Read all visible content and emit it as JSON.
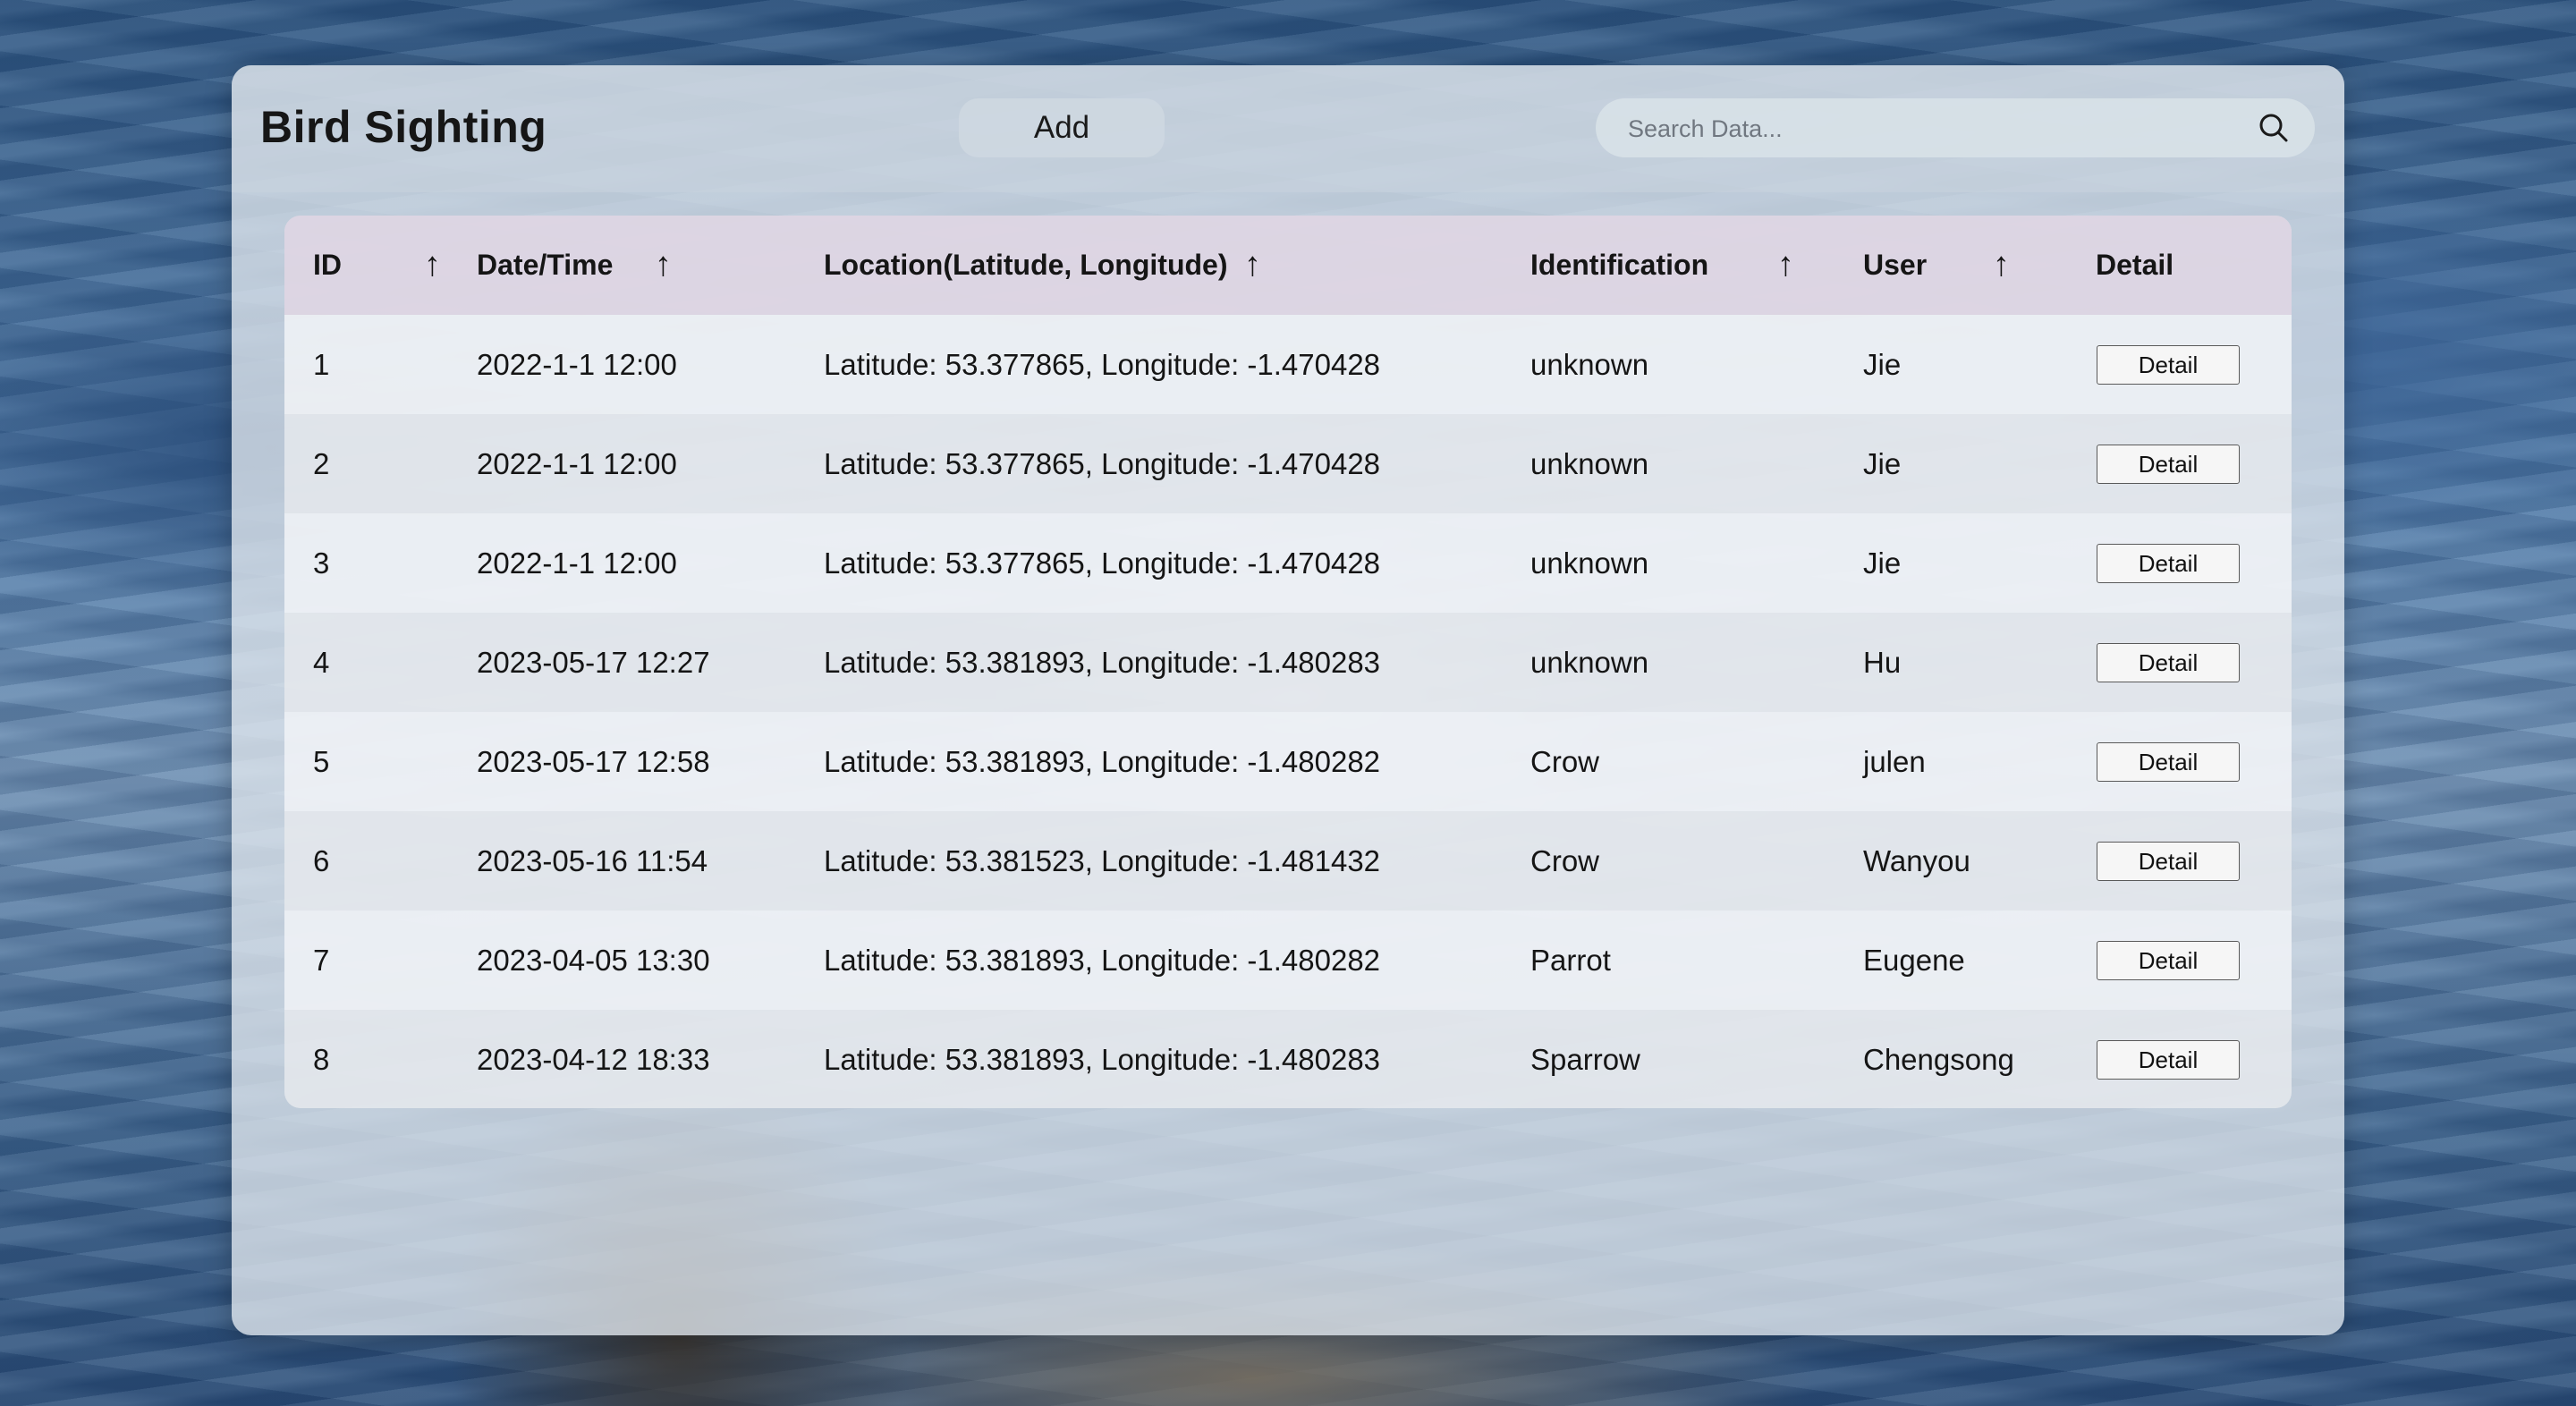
{
  "header": {
    "title": "Bird Sighting",
    "add_label": "Add",
    "search_placeholder": "Search Data..."
  },
  "table": {
    "columns": {
      "id": "ID",
      "datetime": "Date/Time",
      "location": "Location(Latitude, Longitude)",
      "identification": "Identification",
      "user": "User",
      "detail": "Detail"
    },
    "sort_symbol": "↑",
    "rows": [
      {
        "id": "1",
        "datetime": "2022-1-1 12:00",
        "location": "Latitude: 53.377865, Longitude: -1.470428",
        "identification": "unknown",
        "user": "Jie",
        "detail_label": "Detail"
      },
      {
        "id": "2",
        "datetime": "2022-1-1 12:00",
        "location": "Latitude: 53.377865, Longitude: -1.470428",
        "identification": "unknown",
        "user": "Jie",
        "detail_label": "Detail"
      },
      {
        "id": "3",
        "datetime": "2022-1-1 12:00",
        "location": "Latitude: 53.377865, Longitude: -1.470428",
        "identification": "unknown",
        "user": "Jie",
        "detail_label": "Detail"
      },
      {
        "id": "4",
        "datetime": "2023-05-17 12:27",
        "location": "Latitude: 53.381893, Longitude: -1.480283",
        "identification": "unknown",
        "user": "Hu",
        "detail_label": "Detail"
      },
      {
        "id": "5",
        "datetime": "2023-05-17 12:58",
        "location": "Latitude: 53.381893, Longitude: -1.480282",
        "identification": "Crow",
        "user": "julen",
        "detail_label": "Detail"
      },
      {
        "id": "6",
        "datetime": "2023-05-16 11:54",
        "location": "Latitude: 53.381523, Longitude: -1.481432",
        "identification": "Crow",
        "user": "Wanyou",
        "detail_label": "Detail"
      },
      {
        "id": "7",
        "datetime": "2023-04-05 13:30",
        "location": "Latitude: 53.381893, Longitude: -1.480282",
        "identification": "Parrot",
        "user": "Eugene",
        "detail_label": "Detail"
      },
      {
        "id": "8",
        "datetime": "2023-04-12 18:33",
        "location": "Latitude: 53.381893, Longitude: -1.480283",
        "identification": "Sparrow",
        "user": "Chengsong",
        "detail_label": "Detail"
      }
    ]
  },
  "icons": {
    "search": "search-icon",
    "sort": "sort-arrow-up-icon"
  }
}
